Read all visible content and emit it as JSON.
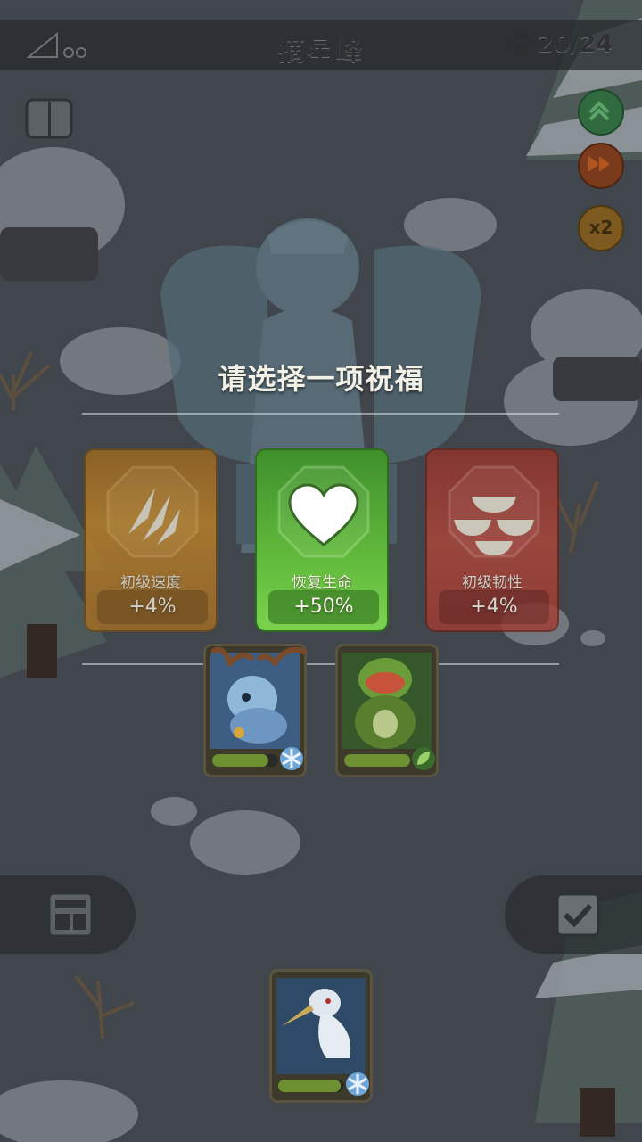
{
  "header": {
    "title": "摘星峰",
    "counter": "20/24"
  },
  "controls": {
    "speed_multiplier": "x2"
  },
  "blessing": {
    "prompt": "请选择一项祝福",
    "options": [
      {
        "name": "初级速度",
        "value": "+4%",
        "icon": "claw-slash-icon",
        "color": "#c08427"
      },
      {
        "name": "恢复生命",
        "value": "+50%",
        "icon": "heart-icon",
        "color": "#5fb73a"
      },
      {
        "name": "初级韧性",
        "value": "+4%",
        "icon": "armor-plates-icon",
        "color": "#b0463a"
      }
    ]
  },
  "team": [
    {
      "name": "blue-deer-hero",
      "element_icon": "snowflake-icon",
      "hp_fraction": 0.85
    },
    {
      "name": "green-monkey-hero",
      "element_icon": "leaf-icon",
      "hp_fraction": 1.0
    },
    {
      "name": "crane-hero",
      "element_icon": "snowflake-icon",
      "hp_fraction": 0.95
    }
  ]
}
